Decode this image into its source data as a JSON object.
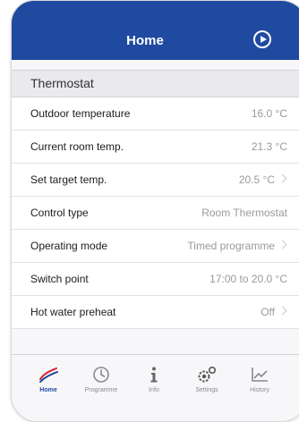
{
  "header": {
    "title": "Home"
  },
  "section": {
    "title": "Thermostat"
  },
  "rows": [
    {
      "label": "Outdoor temperature",
      "value": "16.0 °C"
    },
    {
      "label": "Current room temp.",
      "value": "21.3 °C"
    },
    {
      "label": "Set target temp.",
      "value": "20.5 °C"
    },
    {
      "label": "Control type",
      "value": "Room Thermostat"
    },
    {
      "label": "Operating mode",
      "value": "Timed programme"
    },
    {
      "label": "Switch point",
      "value": "17:00 to 20.0 °C"
    },
    {
      "label": "Hot water preheat",
      "value": "Off"
    }
  ],
  "tabs": [
    {
      "label": "Home",
      "icon": "flame-lines-icon",
      "active": true
    },
    {
      "label": "Programme",
      "icon": "clock-icon"
    },
    {
      "label": "Info",
      "icon": "info-icon"
    },
    {
      "label": "Settings",
      "icon": "gears-icon"
    },
    {
      "label": "History",
      "icon": "chart-icon"
    }
  ],
  "colors": {
    "header_blue": "#1f4aa0",
    "accent_red": "#d9232e",
    "value_gray": "#9a9a9e"
  }
}
